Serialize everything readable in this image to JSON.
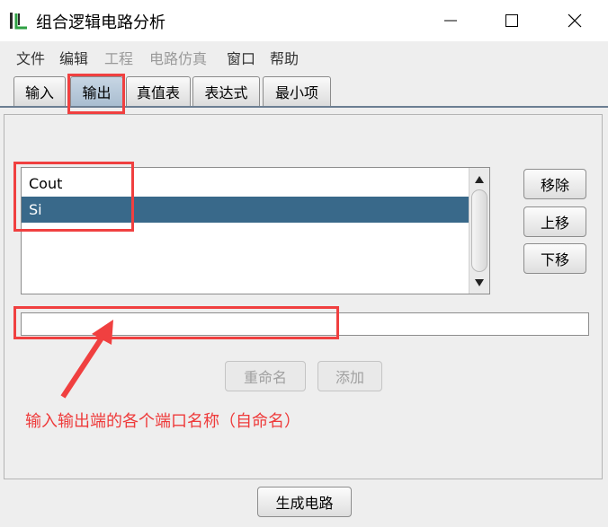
{
  "window": {
    "title": "组合逻辑电路分析",
    "app_icon": "circuit-app-icon"
  },
  "menu": [
    {
      "label": "文件",
      "enabled": true
    },
    {
      "label": "编辑",
      "enabled": true
    },
    {
      "label": "工程",
      "enabled": false
    },
    {
      "label": "电路仿真",
      "enabled": false
    },
    {
      "label": "窗口",
      "enabled": true
    },
    {
      "label": "帮助",
      "enabled": true
    }
  ],
  "tabs": [
    {
      "label": "输入",
      "active": false
    },
    {
      "label": "输出",
      "active": true
    },
    {
      "label": "真值表",
      "active": false
    },
    {
      "label": "表达式",
      "active": false
    },
    {
      "label": "最小项",
      "active": false
    }
  ],
  "outputs": {
    "items": [
      {
        "label": "Cout",
        "selected": false
      },
      {
        "label": "Si",
        "selected": true
      }
    ]
  },
  "buttons": {
    "remove": "移除",
    "move_up": "上移",
    "move_down": "下移",
    "rename": "重命名",
    "add": "添加",
    "generate": "生成电路"
  },
  "name_input": {
    "value": "",
    "placeholder": ""
  },
  "annotation": {
    "text": "输入输出端的各个端口名称（自命名）",
    "color": "#ee3a3a"
  },
  "colors": {
    "selection": "#39698a",
    "tab_active": "#b8cadb",
    "highlight": "#f04040"
  }
}
